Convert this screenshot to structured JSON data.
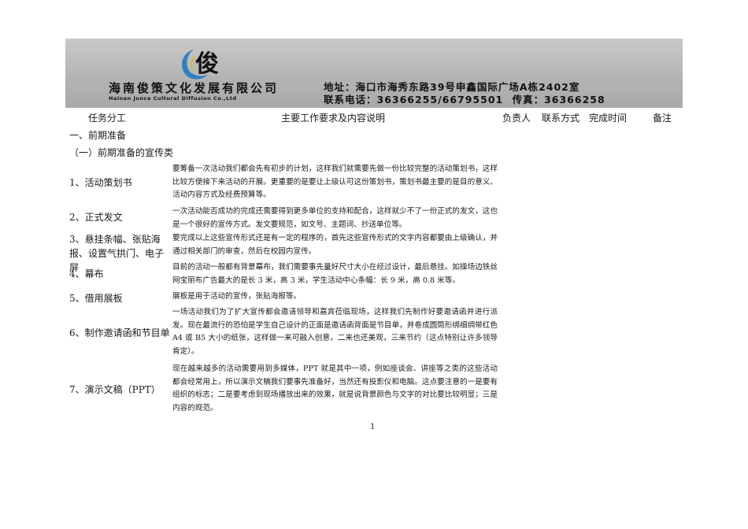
{
  "header": {
    "company_cn": "海南俊策文化发展有限公司",
    "company_en": "Hainan Junce Cultural Diffusion Co.,Ltd",
    "logo_char": "俊",
    "address": "地址：海口市海秀东路39号申鑫国际广场A栋2402室",
    "phone_label": "联系电话：36366255/66795501",
    "fax_label": "传真：36366258",
    "colors": {
      "logo_blue": "#2f7fc1",
      "logo_yellow": "#f0b400"
    }
  },
  "table_header": {
    "task": "任务分工",
    "content": "主要工作要求及内容说明",
    "owner": "负责人",
    "contact": "联系方式",
    "deadline": "完成时间",
    "remark": "备注"
  },
  "section_title": "一、前期准备",
  "subsection_title": "（一）前期准备的宣传类",
  "rows": [
    {
      "label": "1、活动策划书",
      "text": "要筹备一次活动我们都会先有初步的计划，这样我们就需要先做一份比较完整的活动策划书，这样比较方便接下来活动的开展。更重要的是要让上级认可这份策划书，策划书最主要的是目的意义、活动内容方式及经费预算等。"
    },
    {
      "label": "2、正式发文",
      "text": "一次活动能否成功的完成还需要得到更多单位的支持和配合，这样就少不了一份正式的发文，这也是一个很好的宣传方式。发文要规范，如文号、主题词、抄送单位等。"
    },
    {
      "label": "3、悬挂条幅、张贴海报、设置气拱门、电子屏",
      "text": "要完成以上这些宣传形式还是有一定的程序的，首先这些宣传形式的文字内容都要由上级确认，并通过相关部门的审查，然后在校园内宣传。"
    },
    {
      "label": "4、幕布",
      "text": "目前的活动一般都有背景幕布，我们需要事先量好尺寸大小在经过设计，最后悬挂。如操场边铁丝网宝丽布广告最大的是长 3 米，高 3 米，学生活动中心条幅：长 9 米，高 0.8 米等。"
    },
    {
      "label": "5、借用展板",
      "text": "展板是用于活动的宣传，张贴海报等。"
    },
    {
      "label": "6、制作邀请函和节目单",
      "text": "一场活动我们为了扩大宣传都会邀请领导和嘉宾莅临现场，这样我们先制作好要邀请函并进行派发。现在最流行的恐怕是学生自己设计的正面是邀请函背面是节目单，并卷成圆筒形绑细绸带红色 A4 或 B5 大小的纸张，这样做一来可融入创意，二来也还美观，三来节约（这点特别让许多领导肯定）。"
    },
    {
      "label": "7、演示文稿（PPT）",
      "text": "现在越来越多的活动需要用到多媒体，PPT 就是其中一项，例如座谈会、讲座等之类的这些活动都会经常用上，所以演示文稿我们要事先准备好，当然还有投影仪和电脑。这点要注意的一是要有组织的标志；二是要考虑到现场播放出来的效果，就是说背景颜色与文字的对比要比较明显；三是内容的规范。"
    }
  ],
  "page_number": "1"
}
